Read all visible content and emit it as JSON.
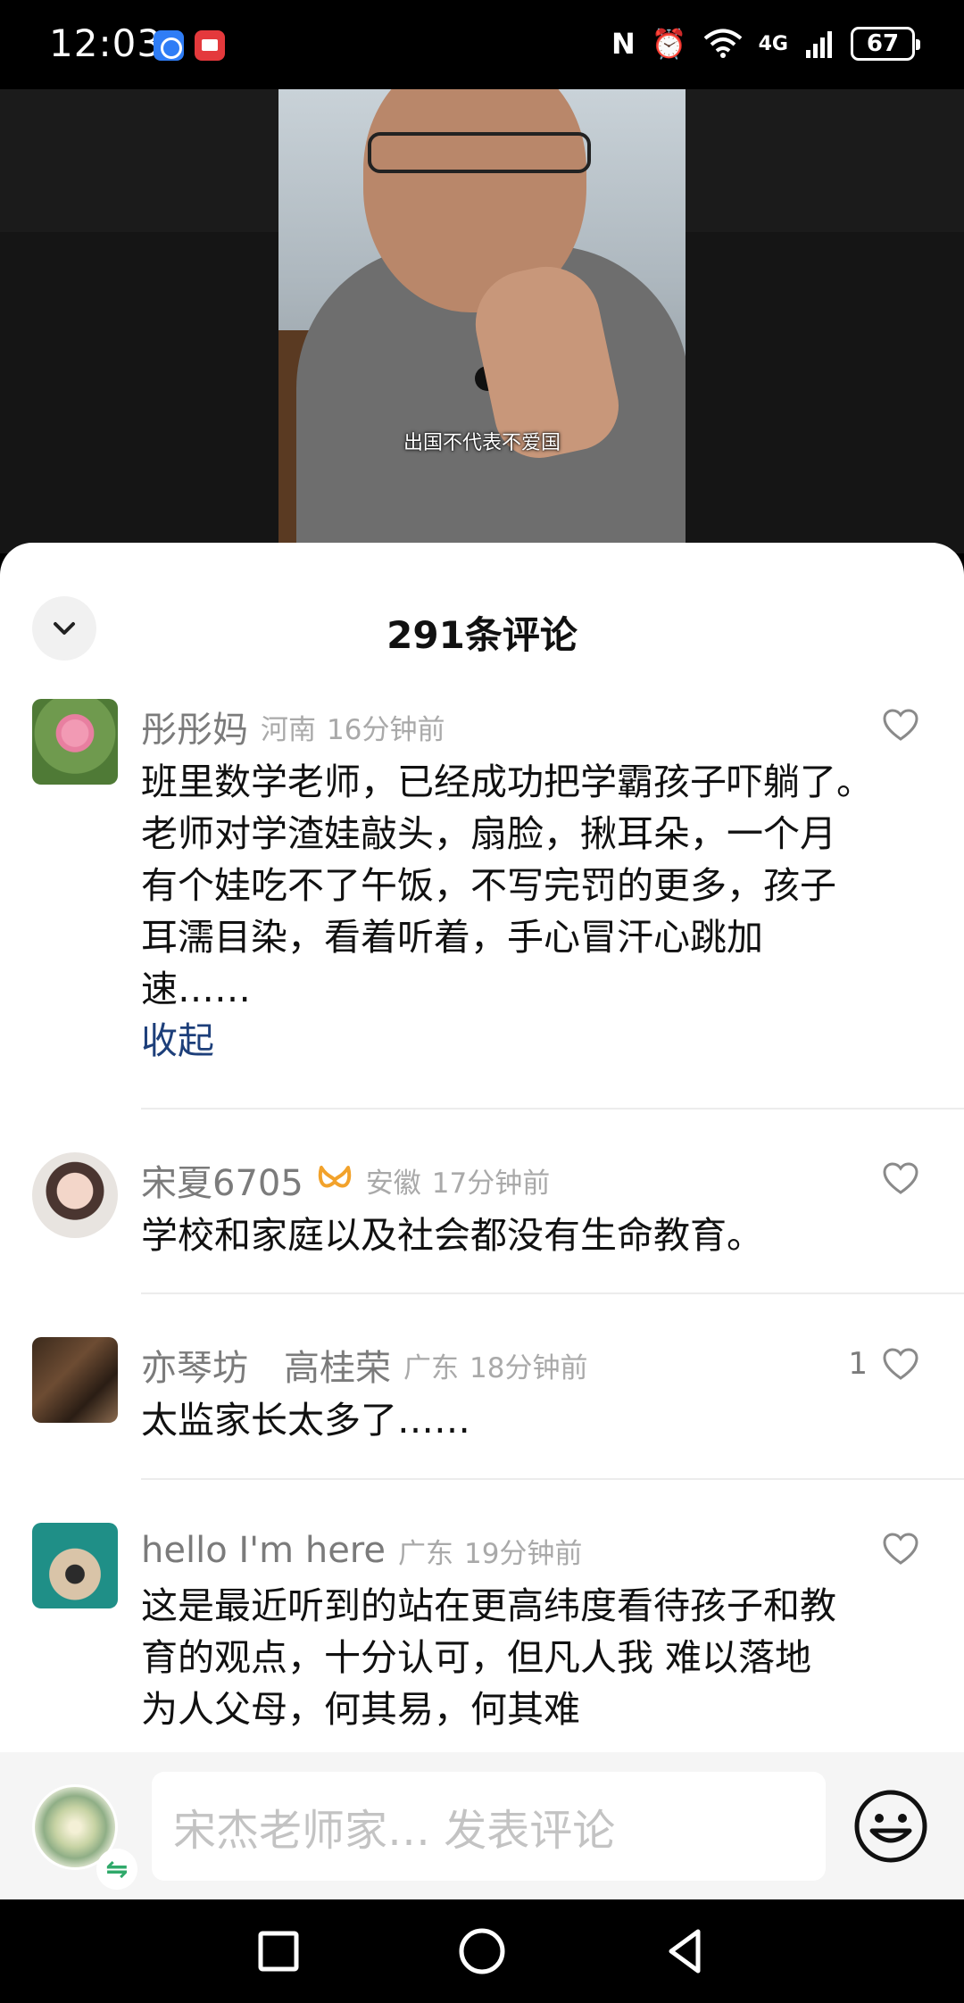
{
  "status_bar": {
    "time": "12:03",
    "network": "4G",
    "battery": "67"
  },
  "video": {
    "subtitle": "出国不代表不爱国"
  },
  "sheet": {
    "title": "291条评论"
  },
  "comments": [
    {
      "username": "彤彤妈",
      "location": "河南",
      "time": "16分钟前",
      "likes": "",
      "lines": [
        "班里数学老师，已经成功把学霸孩子吓躺了。",
        "老师对学渣娃敲头，扇脸，揪耳朵，一个月",
        "有个娃吃不了午饭，不写完罚的更多，孩子",
        "耳濡目染，看着听着，手心冒汗心跳加",
        "速……"
      ],
      "collapse_label": "收起",
      "avatar": "lotus-flower"
    },
    {
      "username": "宋夏6705",
      "location": "安徽",
      "time": "17分钟前",
      "likes": "",
      "lines": [
        "学校和家庭以及社会都没有生命教育。"
      ],
      "avatar": "woman-portrait"
    },
    {
      "username": "亦琴坊　高桂荣",
      "location": "广东",
      "time": "18分钟前",
      "likes": "1",
      "lines": [
        "太监家长太多了……"
      ],
      "avatar": "guqin-instrument"
    },
    {
      "username": "hello I'm here",
      "location": "广东",
      "time": "19分钟前",
      "likes": "",
      "lines": [
        "这是最近听到的站在更高纬度看待孩子和教",
        "育的观点，十分认可，但凡人我  难以落地",
        "为人父母，何其易，何其难"
      ],
      "avatar": "pug-dog"
    }
  ],
  "input_bar": {
    "placeholder": "宋杰老师家… 发表评论",
    "swap_symbol": "⇋"
  },
  "colors": {
    "link": "#1d3f7a",
    "vip_badge": "#f2a22b",
    "meta_gray": "#a9a9a9"
  }
}
